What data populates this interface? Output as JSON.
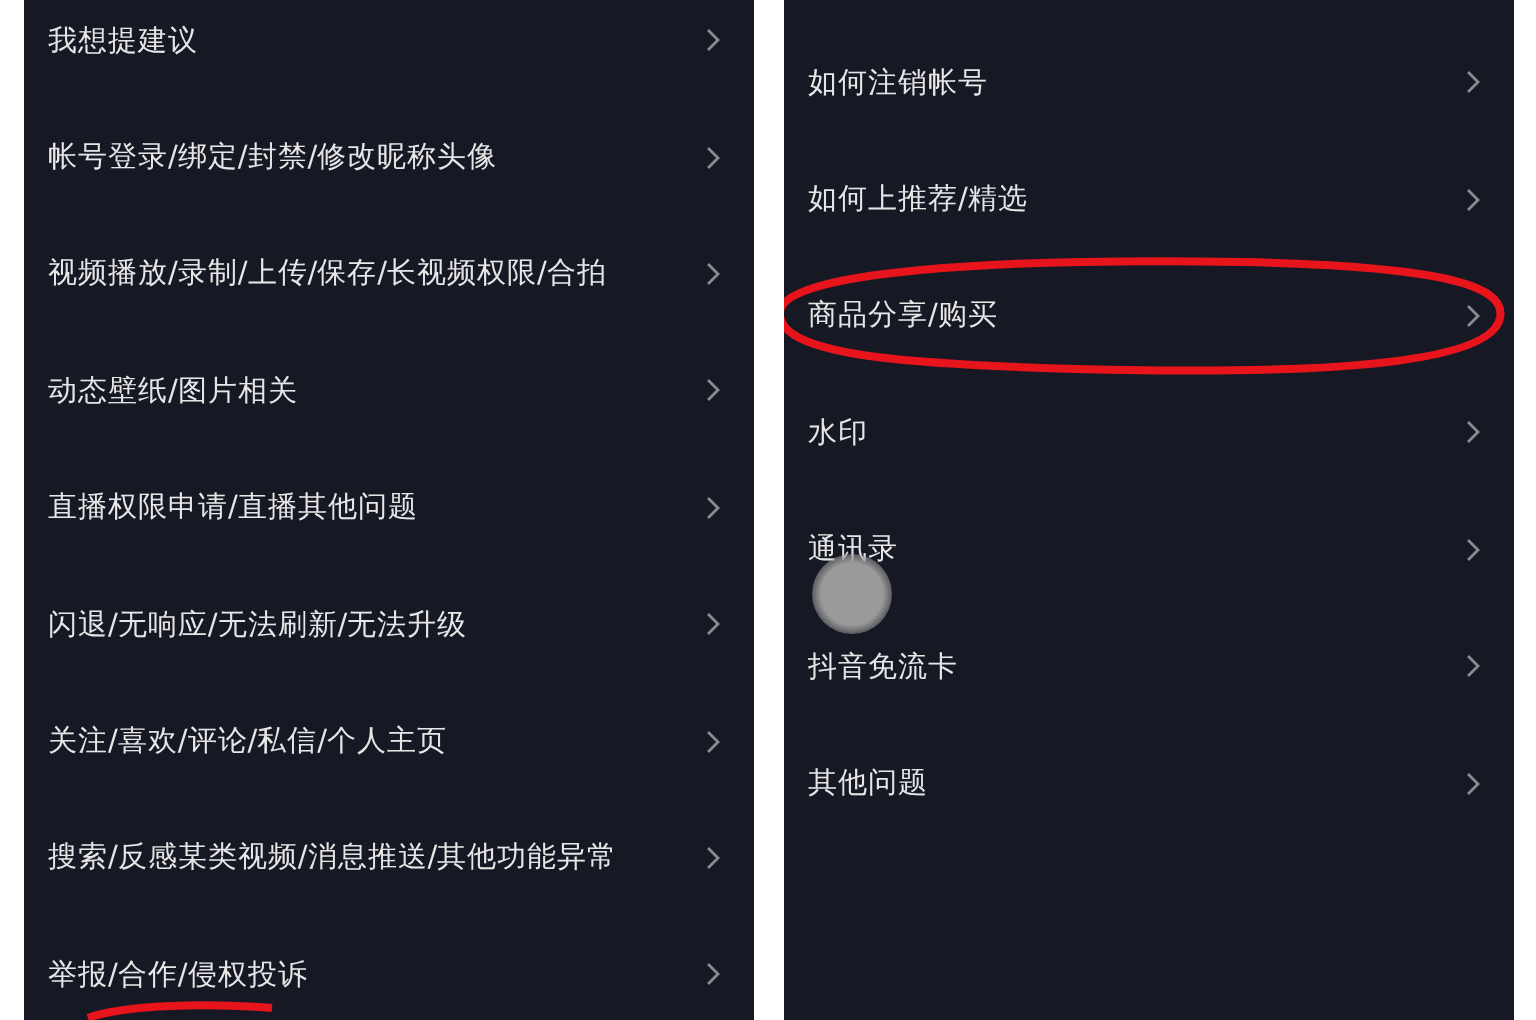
{
  "panels": [
    {
      "items": [
        {
          "label": "我想提建议",
          "circled": false
        },
        {
          "label": "帐号登录/绑定/封禁/修改昵称头像",
          "circled": false
        },
        {
          "label": "视频播放/录制/上传/保存/长视频权限/合拍",
          "circled": false
        },
        {
          "label": "动态壁纸/图片相关",
          "circled": false
        },
        {
          "label": "直播权限申请/直播其他问题",
          "circled": false
        },
        {
          "label": "闪退/无响应/无法刷新/无法升级",
          "circled": false
        },
        {
          "label": "关注/喜欢/评论/私信/个人主页",
          "circled": false
        },
        {
          "label": "搜索/反感某类视频/消息推送/其他功能异常",
          "circled": false
        },
        {
          "label": "举报/合作/侵权投诉",
          "circled": false
        }
      ],
      "bottom_mark": true,
      "touch_indicator": false
    },
    {
      "items": [
        {
          "label": "如何注销帐号",
          "circled": false
        },
        {
          "label": "如何上推荐/精选",
          "circled": false
        },
        {
          "label": "商品分享/购买",
          "circled": true
        },
        {
          "label": "水印",
          "circled": false
        },
        {
          "label": "通讯录",
          "circled": false
        },
        {
          "label": "抖音免流卡",
          "circled": false
        },
        {
          "label": "其他问题",
          "circled": false
        }
      ],
      "bottom_mark": false,
      "touch_indicator": true
    }
  ]
}
